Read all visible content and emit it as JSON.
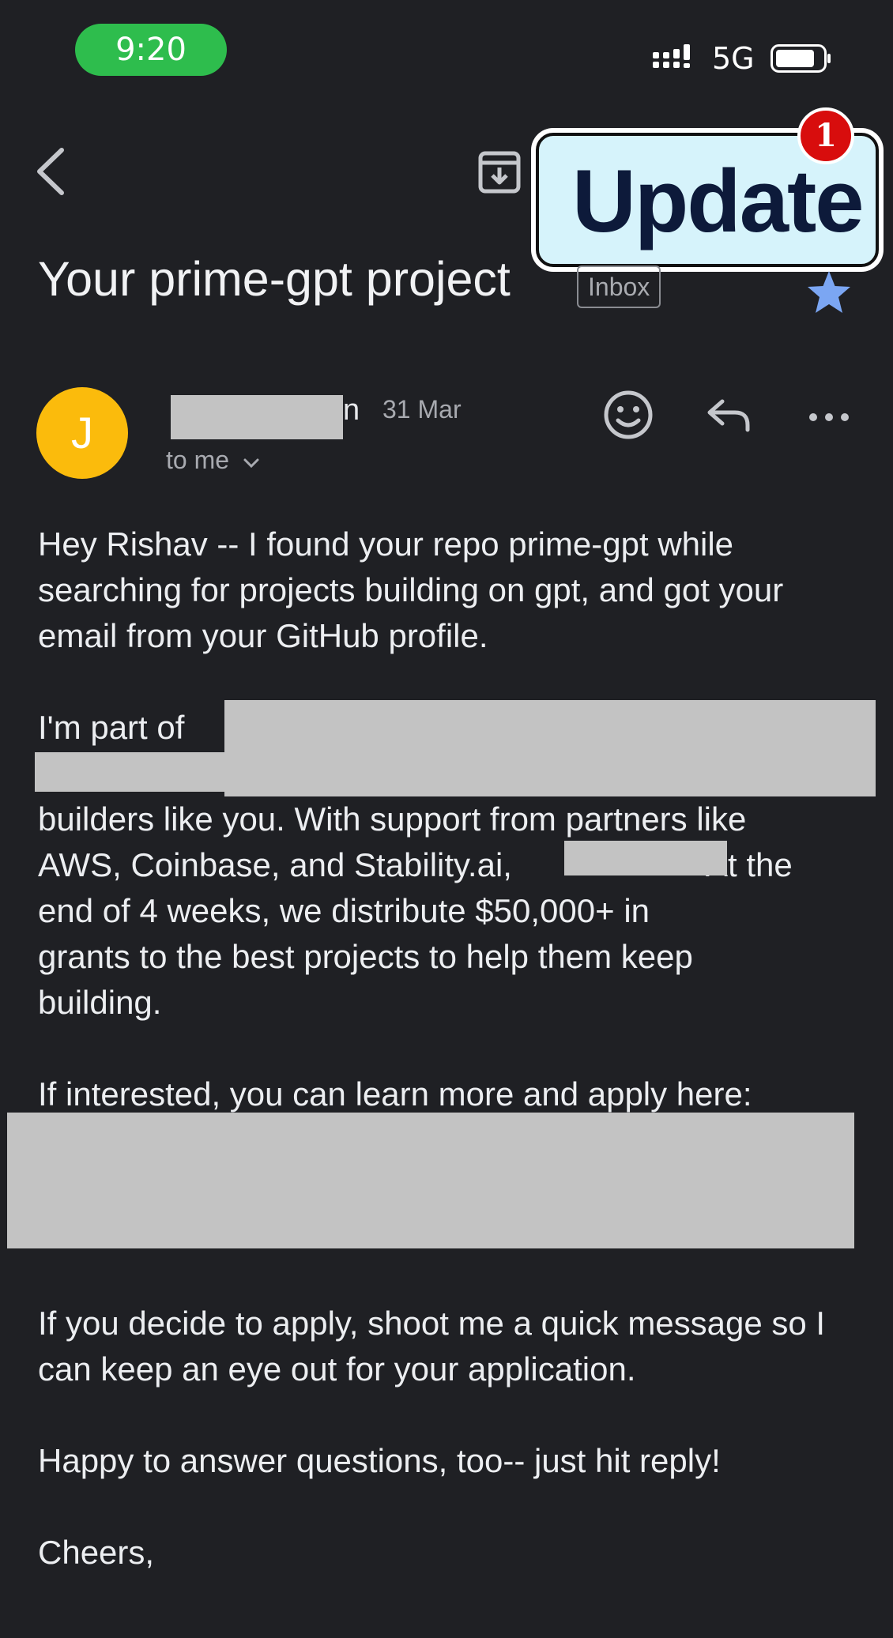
{
  "status_bar": {
    "time": "9:20",
    "network": "5G"
  },
  "email": {
    "subject": "Your prime-gpt project",
    "label": "Inbox",
    "sender": {
      "initial": "J",
      "name_visible_fragment": "n",
      "date": "31 Mar",
      "recipient": "to me"
    },
    "body": {
      "p1": "Hey Rishav -- I found your repo prime-gpt while searching for projects building on gpt, and got your email from your GitHub profile.",
      "p2_start": "I'm part of",
      "p2_l3": "builders like you. With support from partners like",
      "p2_l4a": "AWS, Coinbase, and Stability.ai,",
      "p2_l4b": "At the",
      "p2_l5": "end of 4 weeks, we distribute $50,000+ in",
      "p2_l6": "grants to the best projects to help them keep",
      "p2_l7": "building.",
      "p3": "If interested, you can learn more and apply here:",
      "p4": "If you decide to apply, shoot me a quick message so I can keep an eye out for your application.",
      "p5": "Happy to answer questions, too-- just hit reply!",
      "p6": "Cheers,"
    }
  },
  "overlay": {
    "update_label": "Update",
    "update_count": "1"
  },
  "icons": {
    "back": "back-arrow-icon",
    "archive": "archive-icon",
    "star": "star-icon",
    "emoji": "emoji-icon",
    "reply": "reply-icon",
    "more": "more-icon",
    "chevron": "chevron-down-icon"
  },
  "colors": {
    "background": "#1f2024",
    "star": "#7ba6f3",
    "avatar": "#fbbb0c",
    "time_pill": "#2ebd4d",
    "badge": "#d80d0d"
  }
}
